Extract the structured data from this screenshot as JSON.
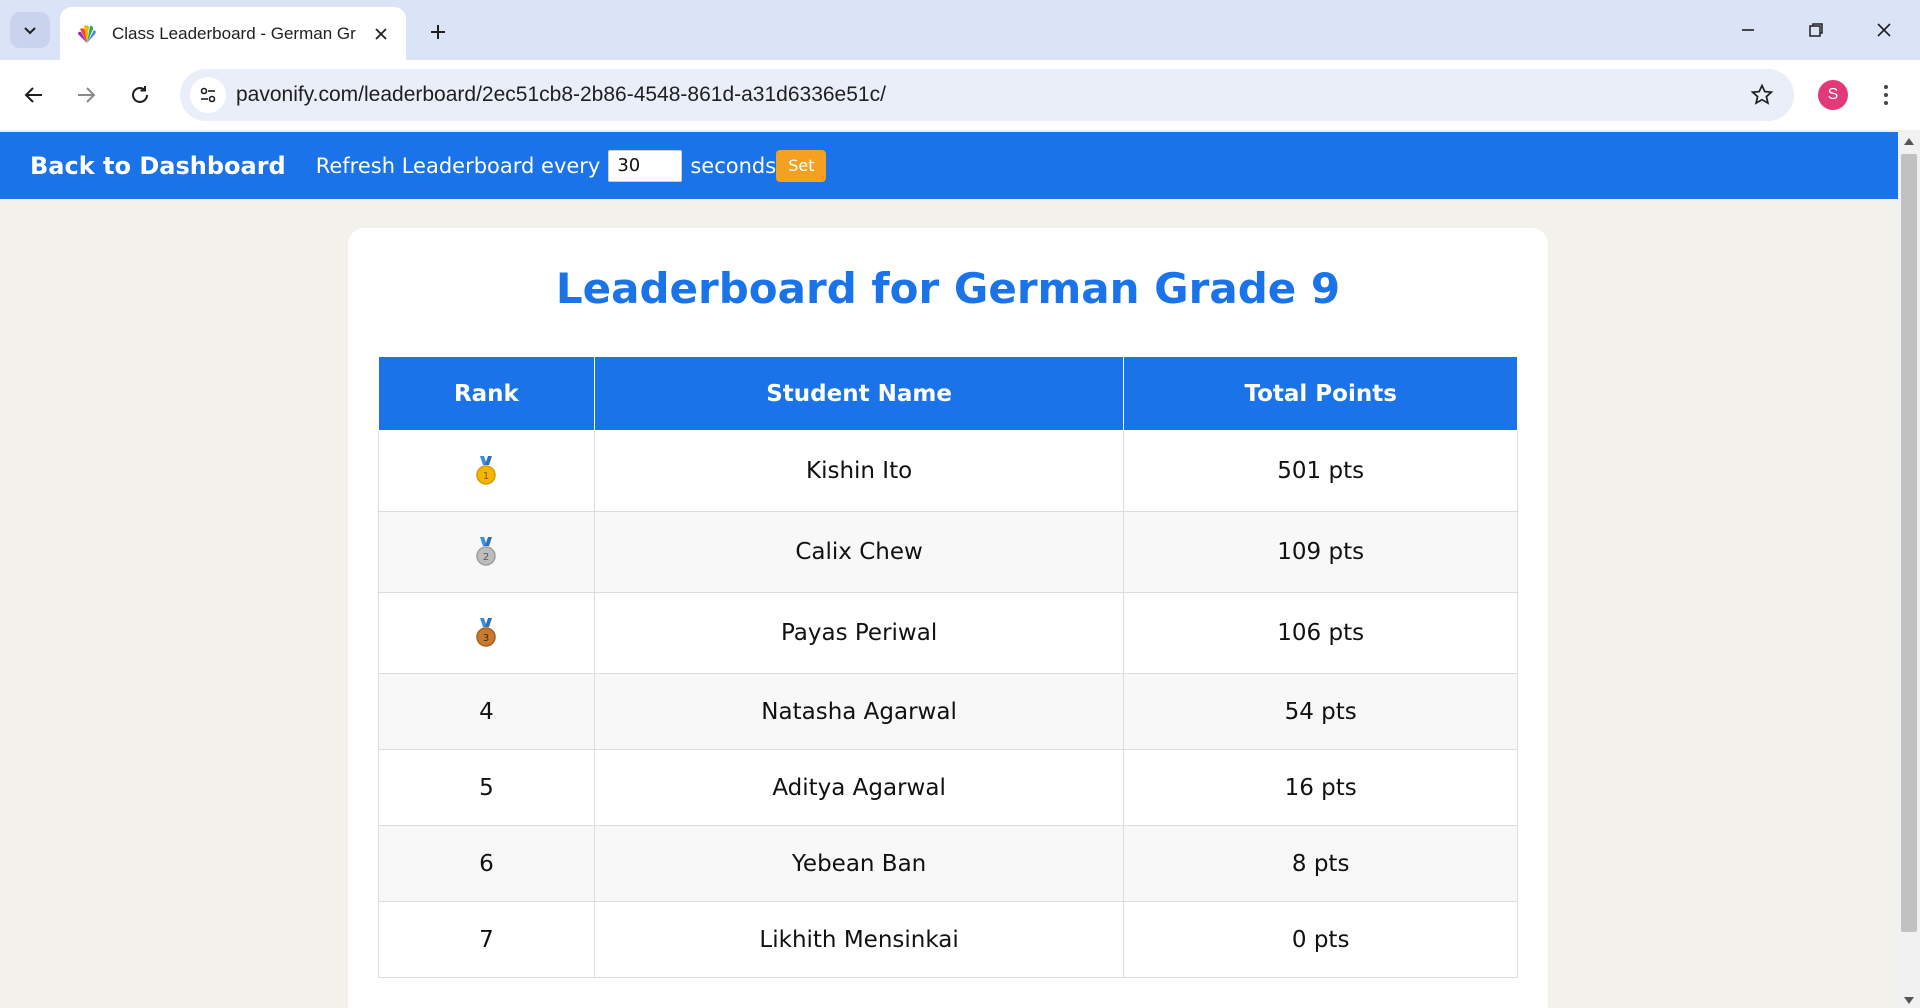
{
  "browser": {
    "tab_title": "Class Leaderboard - German Gr",
    "url": "pavonify.com/leaderboard/2ec51cb8-2b86-4548-861d-a31d6336e51c/",
    "profile_initial": "S"
  },
  "header": {
    "back_label": "Back to Dashboard",
    "refresh_prefix": "Refresh Leaderboard every",
    "refresh_value": "30",
    "refresh_suffix": "seconds",
    "set_label": "Set"
  },
  "main": {
    "title": "Leaderboard for German Grade 9",
    "columns": [
      "Rank",
      "Student Name",
      "Total Points"
    ],
    "rows": [
      {
        "rank": "1",
        "medal": "gold-medal-icon",
        "name": "Kishin Ito",
        "points": "501 pts"
      },
      {
        "rank": "2",
        "medal": "silver-medal-icon",
        "name": "Calix Chew",
        "points": "109 pts"
      },
      {
        "rank": "3",
        "medal": "bronze-medal-icon",
        "name": "Payas Periwal",
        "points": "106 pts"
      },
      {
        "rank": "4",
        "medal": "",
        "name": "Natasha Agarwal",
        "points": "54 pts"
      },
      {
        "rank": "5",
        "medal": "",
        "name": "Aditya Agarwal",
        "points": "16 pts"
      },
      {
        "rank": "6",
        "medal": "",
        "name": "Yebean Ban",
        "points": "8 pts"
      },
      {
        "rank": "7",
        "medal": "",
        "name": "Likhith Mensinkai",
        "points": "0 pts"
      }
    ]
  },
  "colors": {
    "accent": "#1a73e8",
    "button": "#f4a020",
    "background": "#f2f1ec",
    "gold": "#f5b400",
    "silver": "#9e9e9e",
    "bronze": "#c77b30",
    "ribbon": "#3a8fd9"
  }
}
